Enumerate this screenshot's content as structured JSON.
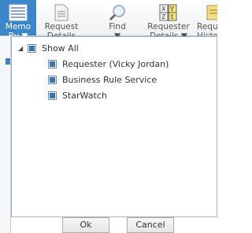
{
  "toolbar": {
    "buttons": [
      {
        "id": "memo-by",
        "label": "Memo\nBy ▼",
        "active": true
      },
      {
        "id": "request-details",
        "label": "Request\nDetails",
        "active": false
      },
      {
        "id": "find",
        "label": "Find\n▼",
        "active": false
      },
      {
        "id": "requester-details",
        "label": "Requester\nDetails ▼",
        "active": false
      },
      {
        "id": "request-history",
        "label": "Reque\nHistor",
        "active": false
      }
    ]
  },
  "tree": {
    "collapse_glyph": "◢",
    "root": {
      "label": "Show All"
    },
    "children": [
      {
        "label": "Requester (Vicky Jordan)"
      },
      {
        "label": "Business Rule Service"
      },
      {
        "label": "StarWatch"
      }
    ]
  },
  "footer": {
    "ok_label": "Ok",
    "cancel_label": "Cancel"
  },
  "colors": {
    "accent": "#3a86c8",
    "checkbox_fill": "#2b78c5"
  }
}
